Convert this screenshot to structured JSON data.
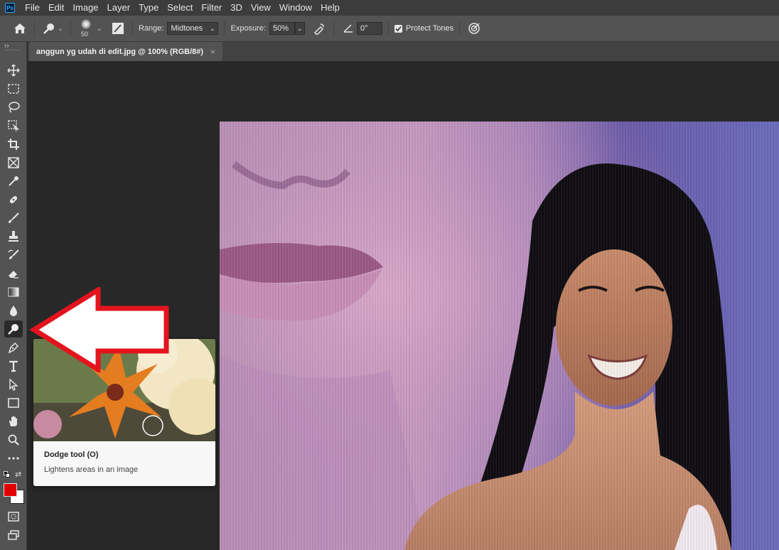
{
  "app": {
    "logo_text": "Ps"
  },
  "menu": [
    "File",
    "Edit",
    "Image",
    "Layer",
    "Type",
    "Select",
    "Filter",
    "3D",
    "View",
    "Window",
    "Help"
  ],
  "options": {
    "brush_size": "50",
    "range_label": "Range:",
    "range_value": "Midtones",
    "exposure_label": "Exposure:",
    "exposure_value": "50%",
    "angle_value": "0°",
    "protect_tones_label": "Protect Tones",
    "protect_tones_checked": true
  },
  "document": {
    "tab_title": "anggun yg udah di edit.jpg @ 100% (RGB/8#)",
    "close_glyph": "×"
  },
  "toolbar": {
    "collapse_glyph": "››",
    "active_tool": "dodge-tool",
    "foreground_color": "#e00000",
    "background_color": "#ffffff"
  },
  "tooltip": {
    "title": "Dodge tool (O)",
    "description": "Lightens areas in an image"
  },
  "colors": {
    "menubar_bg": "#3c3c3c",
    "panel_bg": "#535353",
    "canvas_bg": "#282828",
    "arrow_stroke": "#e3141e",
    "arrow_fill": "#ffffff"
  }
}
